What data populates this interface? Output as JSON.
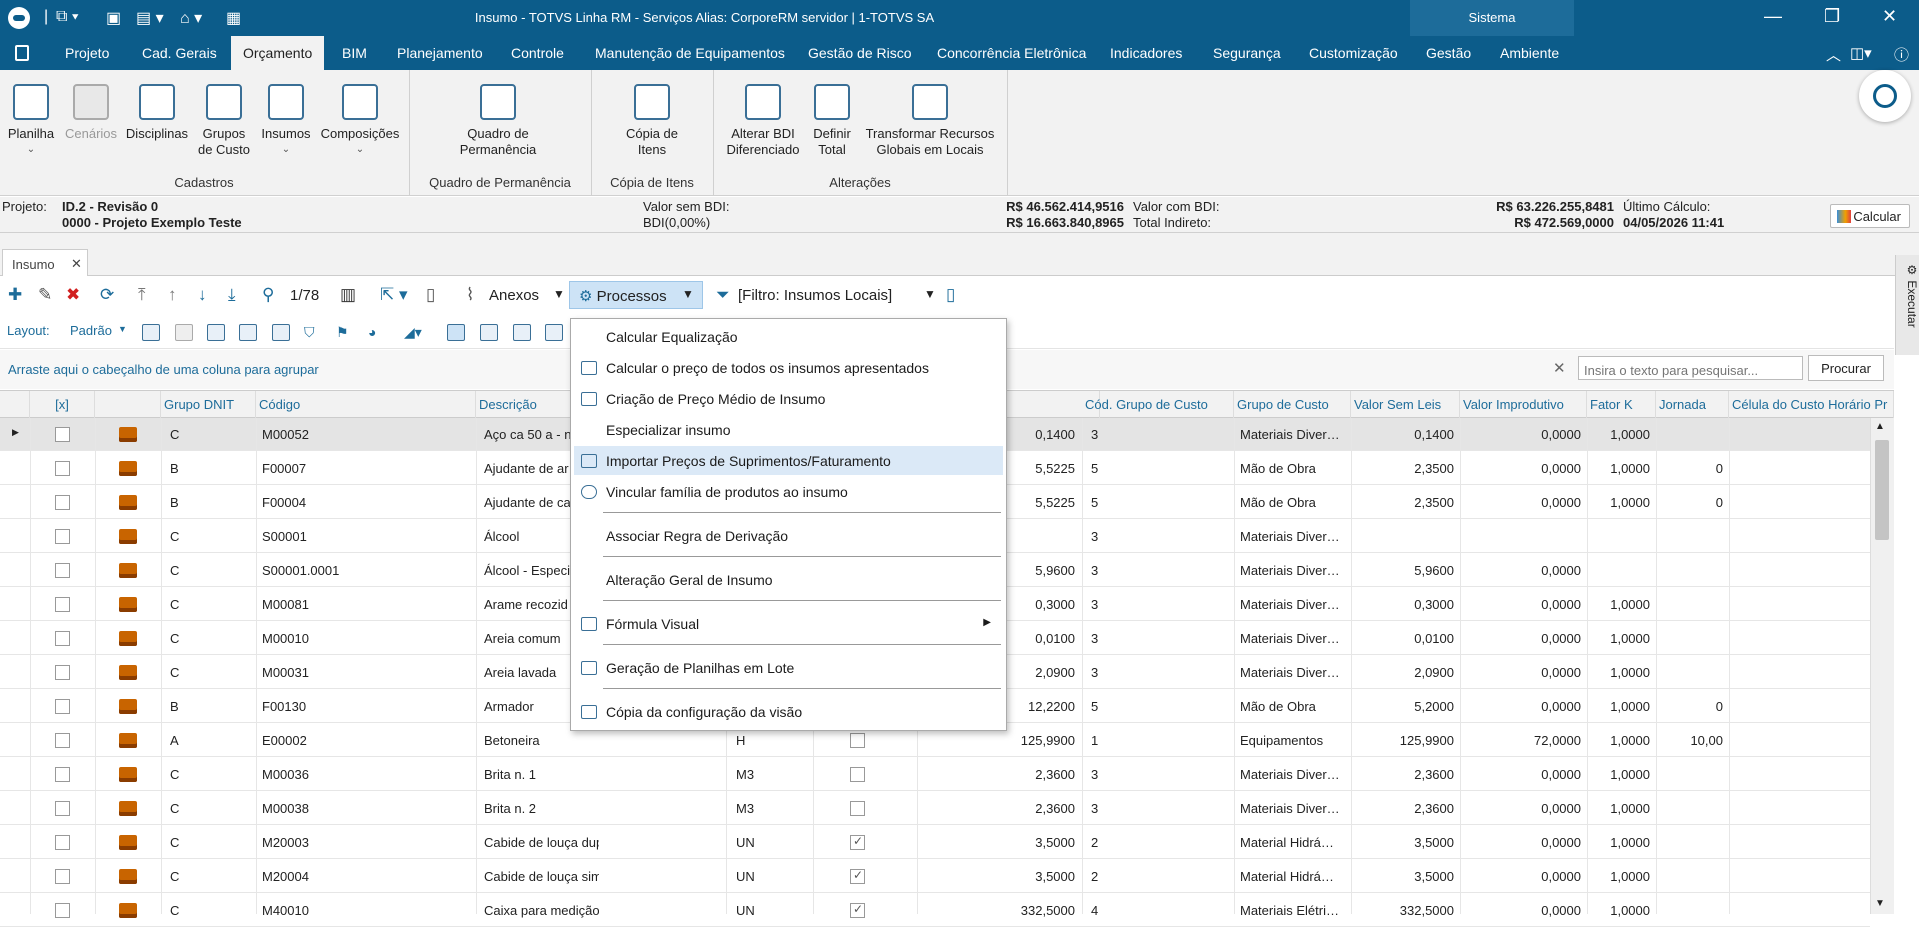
{
  "titlebar": {
    "title": "Insumo - TOTVS Linha RM - Serviços  Alias: CorporeRM servidor  | 1-TOTVS SA",
    "sistema": "Sistema"
  },
  "menu_tabs": [
    "Projeto",
    "Cad. Gerais",
    "Orçamento",
    "BIM",
    "Planejamento",
    "Controle",
    "Manutenção de Equipamentos",
    "Gestão de Risco",
    "Concorrência Eletrônica",
    "Indicadores",
    "Segurança",
    "Customização",
    "Gestão",
    "Ambiente"
  ],
  "ribbon": {
    "cadastros": [
      "Planilha",
      "Cenários",
      "Disciplinas",
      "Grupos\nde Custo",
      "Insumos",
      "Composições"
    ],
    "cadastros_label": "Cadastros",
    "quadro_btn": "Quadro de\nPermanência",
    "quadro_label": "Quadro de Permanência",
    "copia_btn": "Cópia de\nItens",
    "copia_label": "Cópia de Itens",
    "alt1": "Alterar BDI\nDiferenciado",
    "alt2": "Definir\nTotal",
    "alt3": "Transformar Recursos\nGlobais em Locais",
    "alt_label": "Alterações"
  },
  "project": {
    "label": "Projeto:",
    "id": "ID.2 - Revisão 0",
    "name": "0000 - Projeto Exemplo Teste",
    "vsb_label": "Valor sem BDI:",
    "bdi_label": "BDI(0,00%)",
    "vsb": "R$ 46.562.414,9516",
    "bdi": "R$ 16.663.840,8965",
    "vcb_label": "Valor com BDI:",
    "ti_label": "Total Indireto:",
    "vcb": "R$ 63.226.255,8481",
    "ti": "R$ 472.569,0000",
    "uc_label": "Último Cálculo:",
    "uc": "04/05/2026 11:41",
    "calc_btn": "Calcular"
  },
  "doctab": "Insumo",
  "exec": "Executar",
  "toolbar": {
    "pager": "1/78",
    "anexos": "Anexos",
    "processos": "Processos",
    "filtro": "[Filtro: Insumos Locais]"
  },
  "layout": {
    "label": "Layout:",
    "value": "Padrão"
  },
  "group_hint": "Arraste aqui o cabeçalho de uma coluna para agrupar",
  "search": {
    "placeholder": "Insira o texto para pesquisar...",
    "button": "Procurar"
  },
  "columns": [
    "[x]",
    "Grupo DNIT",
    "Código",
    "Descrição",
    "Cód. Grupo de Custo",
    "Grupo de Custo",
    "Valor Sem Leis",
    "Valor Improdutivo",
    "Fator K",
    "Jornada",
    "Célula do Custo Horário Pr"
  ],
  "rows": [
    {
      "g": "C",
      "cod": "M00052",
      "desc": "Aço ca 50 a - n",
      "un": "",
      "chk": false,
      "val": "0,1400",
      "cgc": "3",
      "gc": "Materiais Diver…",
      "vsl": "0,1400",
      "vi": "0,0000",
      "fk": "1,0000",
      "jor": ""
    },
    {
      "g": "B",
      "cod": "F00007",
      "desc": "Ajudante de ar",
      "un": "",
      "chk": false,
      "val": "5,5225",
      "cgc": "5",
      "gc": "Mão de Obra",
      "vsl": "2,3500",
      "vi": "0,0000",
      "fk": "1,0000",
      "jor": "0"
    },
    {
      "g": "B",
      "cod": "F00004",
      "desc": "Ajudante de ca",
      "un": "",
      "chk": false,
      "val": "5,5225",
      "cgc": "5",
      "gc": "Mão de Obra",
      "vsl": "2,3500",
      "vi": "0,0000",
      "fk": "1,0000",
      "jor": "0"
    },
    {
      "g": "C",
      "cod": "S00001",
      "desc": "Álcool",
      "un": "",
      "chk": false,
      "val": "",
      "cgc": "3",
      "gc": "Materiais Diver…",
      "vsl": "",
      "vi": "",
      "fk": "",
      "jor": ""
    },
    {
      "g": "C",
      "cod": "S00001.0001",
      "desc": "Álcool - Especi",
      "un": "",
      "chk": false,
      "val": "5,9600",
      "cgc": "3",
      "gc": "Materiais Diver…",
      "vsl": "5,9600",
      "vi": "0,0000",
      "fk": "",
      "jor": ""
    },
    {
      "g": "C",
      "cod": "M00081",
      "desc": "Arame recozid",
      "un": "",
      "chk": false,
      "val": "0,3000",
      "cgc": "3",
      "gc": "Materiais Diver…",
      "vsl": "0,3000",
      "vi": "0,0000",
      "fk": "1,0000",
      "jor": ""
    },
    {
      "g": "C",
      "cod": "M00010",
      "desc": "Areia comum",
      "un": "",
      "chk": false,
      "val": "0,0100",
      "cgc": "3",
      "gc": "Materiais Diver…",
      "vsl": "0,0100",
      "vi": "0,0000",
      "fk": "1,0000",
      "jor": ""
    },
    {
      "g": "C",
      "cod": "M00031",
      "desc": "Areia lavada",
      "un": "",
      "chk": false,
      "val": "2,0900",
      "cgc": "3",
      "gc": "Materiais Diver…",
      "vsl": "2,0900",
      "vi": "0,0000",
      "fk": "1,0000",
      "jor": ""
    },
    {
      "g": "B",
      "cod": "F00130",
      "desc": "Armador",
      "un": "",
      "chk": false,
      "val": "12,2200",
      "cgc": "5",
      "gc": "Mão de Obra",
      "vsl": "5,2000",
      "vi": "0,0000",
      "fk": "1,0000",
      "jor": "0"
    },
    {
      "g": "A",
      "cod": "E00002",
      "desc": "Betoneira",
      "un": "H",
      "chk": false,
      "val": "125,9900",
      "cgc": "1",
      "gc": "Equipamentos",
      "vsl": "125,9900",
      "vi": "72,0000",
      "fk": "1,0000",
      "jor": "10,00"
    },
    {
      "g": "C",
      "cod": "M00036",
      "desc": "Brita n. 1",
      "un": "M3",
      "chk": false,
      "val": "2,3600",
      "cgc": "3",
      "gc": "Materiais Diver…",
      "vsl": "2,3600",
      "vi": "0,0000",
      "fk": "1,0000",
      "jor": ""
    },
    {
      "g": "C",
      "cod": "M00038",
      "desc": "Brita n. 2",
      "un": "M3",
      "chk": false,
      "val": "2,3600",
      "cgc": "3",
      "gc": "Materiais Diver…",
      "vsl": "2,3600",
      "vi": "0,0000",
      "fk": "1,0000",
      "jor": ""
    },
    {
      "g": "C",
      "cod": "M20003",
      "desc": "Cabide de louça duplo",
      "un": "UN",
      "chk": true,
      "val": "3,5000",
      "cgc": "2",
      "gc": "Material Hidrá…",
      "vsl": "3,5000",
      "vi": "0,0000",
      "fk": "1,0000",
      "jor": ""
    },
    {
      "g": "C",
      "cod": "M20004",
      "desc": "Cabide de louça simples",
      "un": "UN",
      "chk": true,
      "val": "3,5000",
      "cgc": "2",
      "gc": "Material Hidrá…",
      "vsl": "3,5000",
      "vi": "0,0000",
      "fk": "1,0000",
      "jor": ""
    },
    {
      "g": "C",
      "cod": "M40010",
      "desc": "Caixa para medição",
      "un": "UN",
      "chk": true,
      "val": "332,5000",
      "cgc": "4",
      "gc": "Materiais Elétri…",
      "vsl": "332,5000",
      "vi": "0,0000",
      "fk": "1,0000",
      "jor": ""
    }
  ],
  "process_menu": [
    "Calcular Equalização",
    "Calcular o preço de todos os insumos apresentados",
    "Criação de Preço Médio de Insumo",
    "Especializar insumo",
    "Importar Preços de Suprimentos/Faturamento",
    "Vincular família de produtos ao insumo",
    "Associar Regra de Derivação",
    "Alteração Geral de Insumo",
    "Fórmula Visual",
    "Geração de Planilhas em Lote",
    "Cópia da configuração da visão"
  ]
}
